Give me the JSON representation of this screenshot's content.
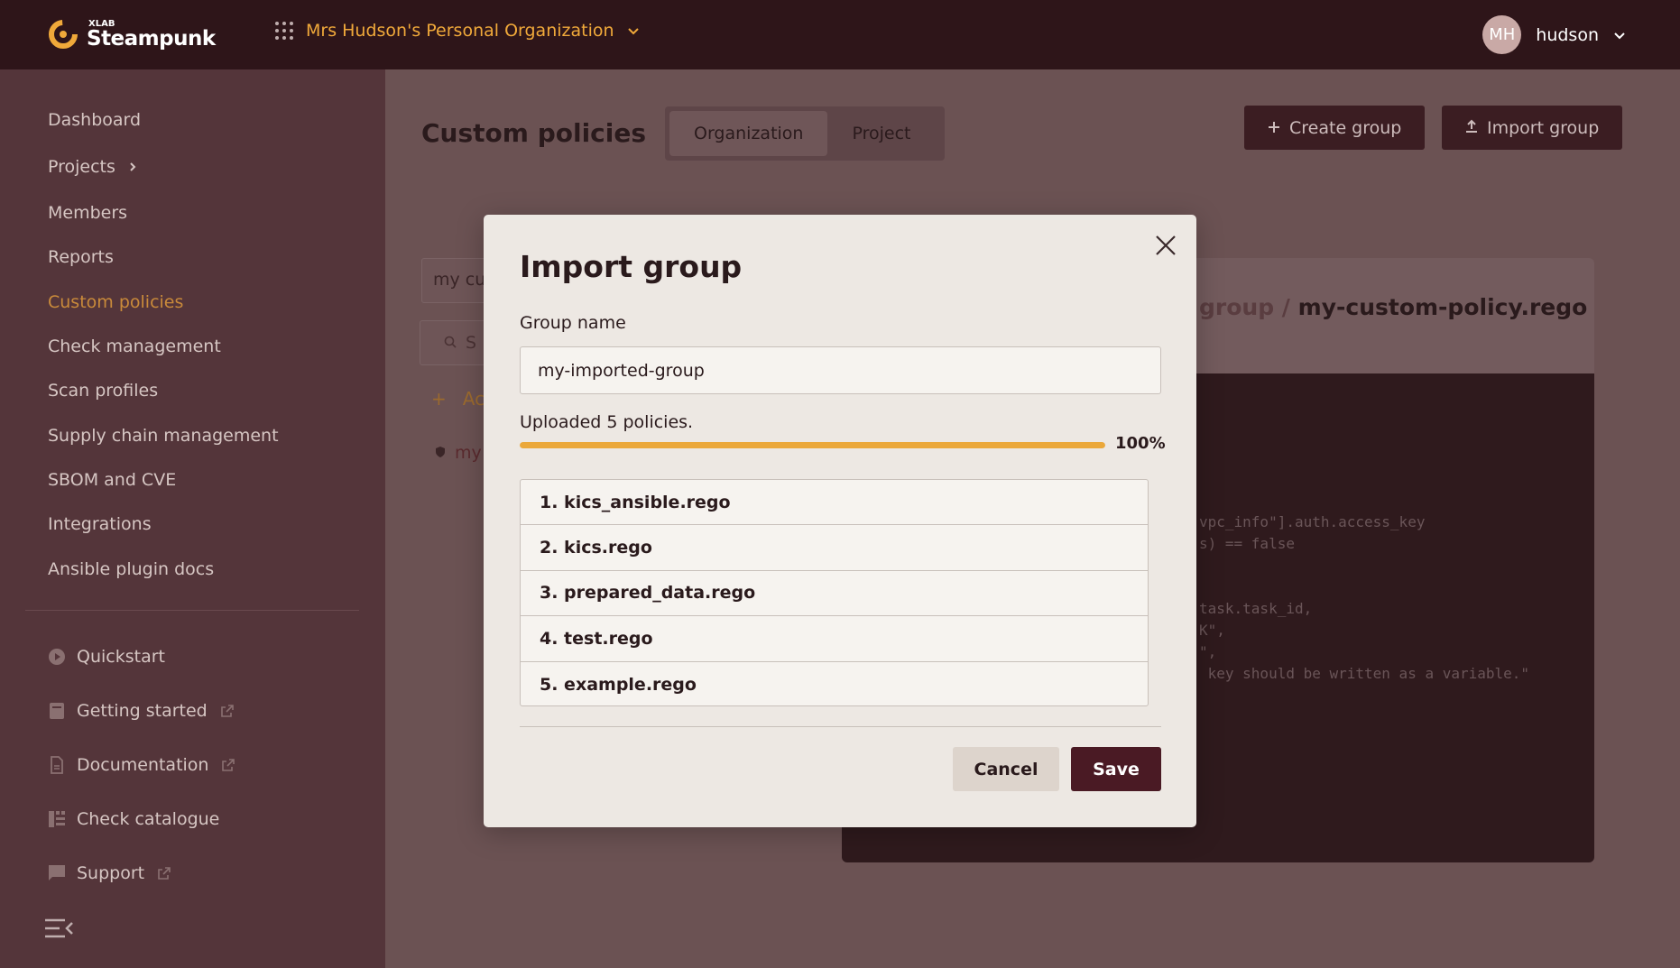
{
  "app": {
    "brand_small": "XLAB",
    "brand": "Steampunk",
    "org_name": "Mrs Hudson's Personal Organization"
  },
  "user": {
    "initials": "MH",
    "name": "hudson"
  },
  "sidebar": {
    "items": [
      {
        "label": "Dashboard"
      },
      {
        "label": "Projects"
      },
      {
        "label": "Members"
      },
      {
        "label": "Reports"
      },
      {
        "label": "Custom policies",
        "active": true
      },
      {
        "label": "Check management"
      },
      {
        "label": "Scan profiles"
      },
      {
        "label": "Supply chain management"
      },
      {
        "label": "SBOM and CVE"
      },
      {
        "label": "Integrations"
      },
      {
        "label": "Ansible plugin docs"
      }
    ],
    "links": [
      {
        "label": "Quickstart",
        "icon": "play-circle-icon"
      },
      {
        "label": "Getting started",
        "icon": "book-icon"
      },
      {
        "label": "Documentation",
        "icon": "document-icon"
      },
      {
        "label": "Check catalogue",
        "icon": "catalogue-icon"
      },
      {
        "label": "Support",
        "icon": "chat-icon"
      }
    ]
  },
  "main": {
    "title": "Custom policies",
    "tabs": [
      {
        "label": "Organization",
        "selected": true
      },
      {
        "label": "Project"
      }
    ],
    "create_group_label": "Create group",
    "import_group_label": "Import group",
    "filter_value": "my cu",
    "search_placeholder": "S",
    "add_label": "Ac",
    "list_item": "my",
    "file_path_prefix": "group /",
    "file_name": "my-custom-policy.rego",
    "code_lines": [
      "vpc_info\"].auth.access_key",
      "s) == false",
      "task.task_id,",
      "K\",",
      "\",",
      " key should be written as a variable.\""
    ]
  },
  "modal": {
    "title": "Import group",
    "group_name_label": "Group name",
    "group_name_value": "my-imported-group",
    "upload_status": "Uploaded 5 policies.",
    "progress_percent": 100,
    "progress_label": "100%",
    "files": [
      "1. kics_ansible.rego",
      "2. kics.rego",
      "3. prepared_data.rego",
      "4. test.rego",
      "5. example.rego"
    ],
    "cancel_label": "Cancel",
    "save_label": "Save"
  },
  "colors": {
    "accent": "#eba83a",
    "brand_dark": "#4a1a24",
    "topbar": "#2e1519"
  }
}
